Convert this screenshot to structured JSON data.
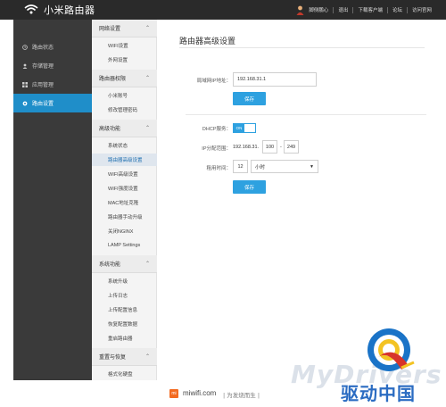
{
  "app": {
    "title": "小米路由器"
  },
  "topnav": {
    "user": "脚侧鹏心",
    "items": [
      "退出",
      "下载客户端",
      "论坛",
      "访问官网"
    ]
  },
  "sidebar": {
    "items": [
      {
        "label": "路由状态",
        "icon": "clock-icon"
      },
      {
        "label": "存储管理",
        "icon": "user-icon"
      },
      {
        "label": "应用管理",
        "icon": "grid-icon"
      },
      {
        "label": "路由设置",
        "icon": "gear-icon"
      }
    ],
    "active_index": 3
  },
  "submenu": {
    "sections": [
      {
        "title": "网络设置",
        "items": [
          "WIFI设置",
          "外网设置"
        ]
      },
      {
        "title": "路由器权限",
        "items": [
          "小米账号",
          "修改管理密码"
        ]
      },
      {
        "title": "高级功能",
        "items": [
          "系统状态",
          "路由器高级设置",
          "WIFI高级设置",
          "WIFI强度设置",
          "MAC地址克隆",
          "路由器手动升级",
          "关闭NGINX",
          "LAMP Settings"
        ]
      },
      {
        "title": "系统功能",
        "items": [
          "系统升级",
          "上传日志",
          "上传配置信息",
          "恢复配置数据",
          "重启路由器"
        ]
      },
      {
        "title": "重置与恢复",
        "items": [
          "格式化硬盘"
        ]
      }
    ],
    "active_item": "路由器高级设置"
  },
  "main": {
    "title": "路由器高级设置",
    "lan": {
      "label": "局域网IP地址：",
      "value": "192.168.31.1",
      "save": "保存"
    },
    "dhcp": {
      "label": "DHCP服务：",
      "toggle": "ON",
      "range_label": "IP分配范围：",
      "range_prefix": "192.168.31.",
      "range_start": "100",
      "range_sep": "-",
      "range_end": "249",
      "lease_label": "租用时间：",
      "lease_value": "12",
      "lease_unit": "小时",
      "save": "保存"
    }
  },
  "footer": {
    "logo": "mi",
    "domain": "miwifi.com",
    "slogan": "| 为发烧而生 |"
  },
  "watermark": {
    "text": "MyDrivers",
    "cn": "驱动中国"
  },
  "colors": {
    "accent": "#2ea1e0",
    "sidebar": "#3a3a3a",
    "topbar": "#2a2a2a",
    "active": "#1f8ec9"
  }
}
